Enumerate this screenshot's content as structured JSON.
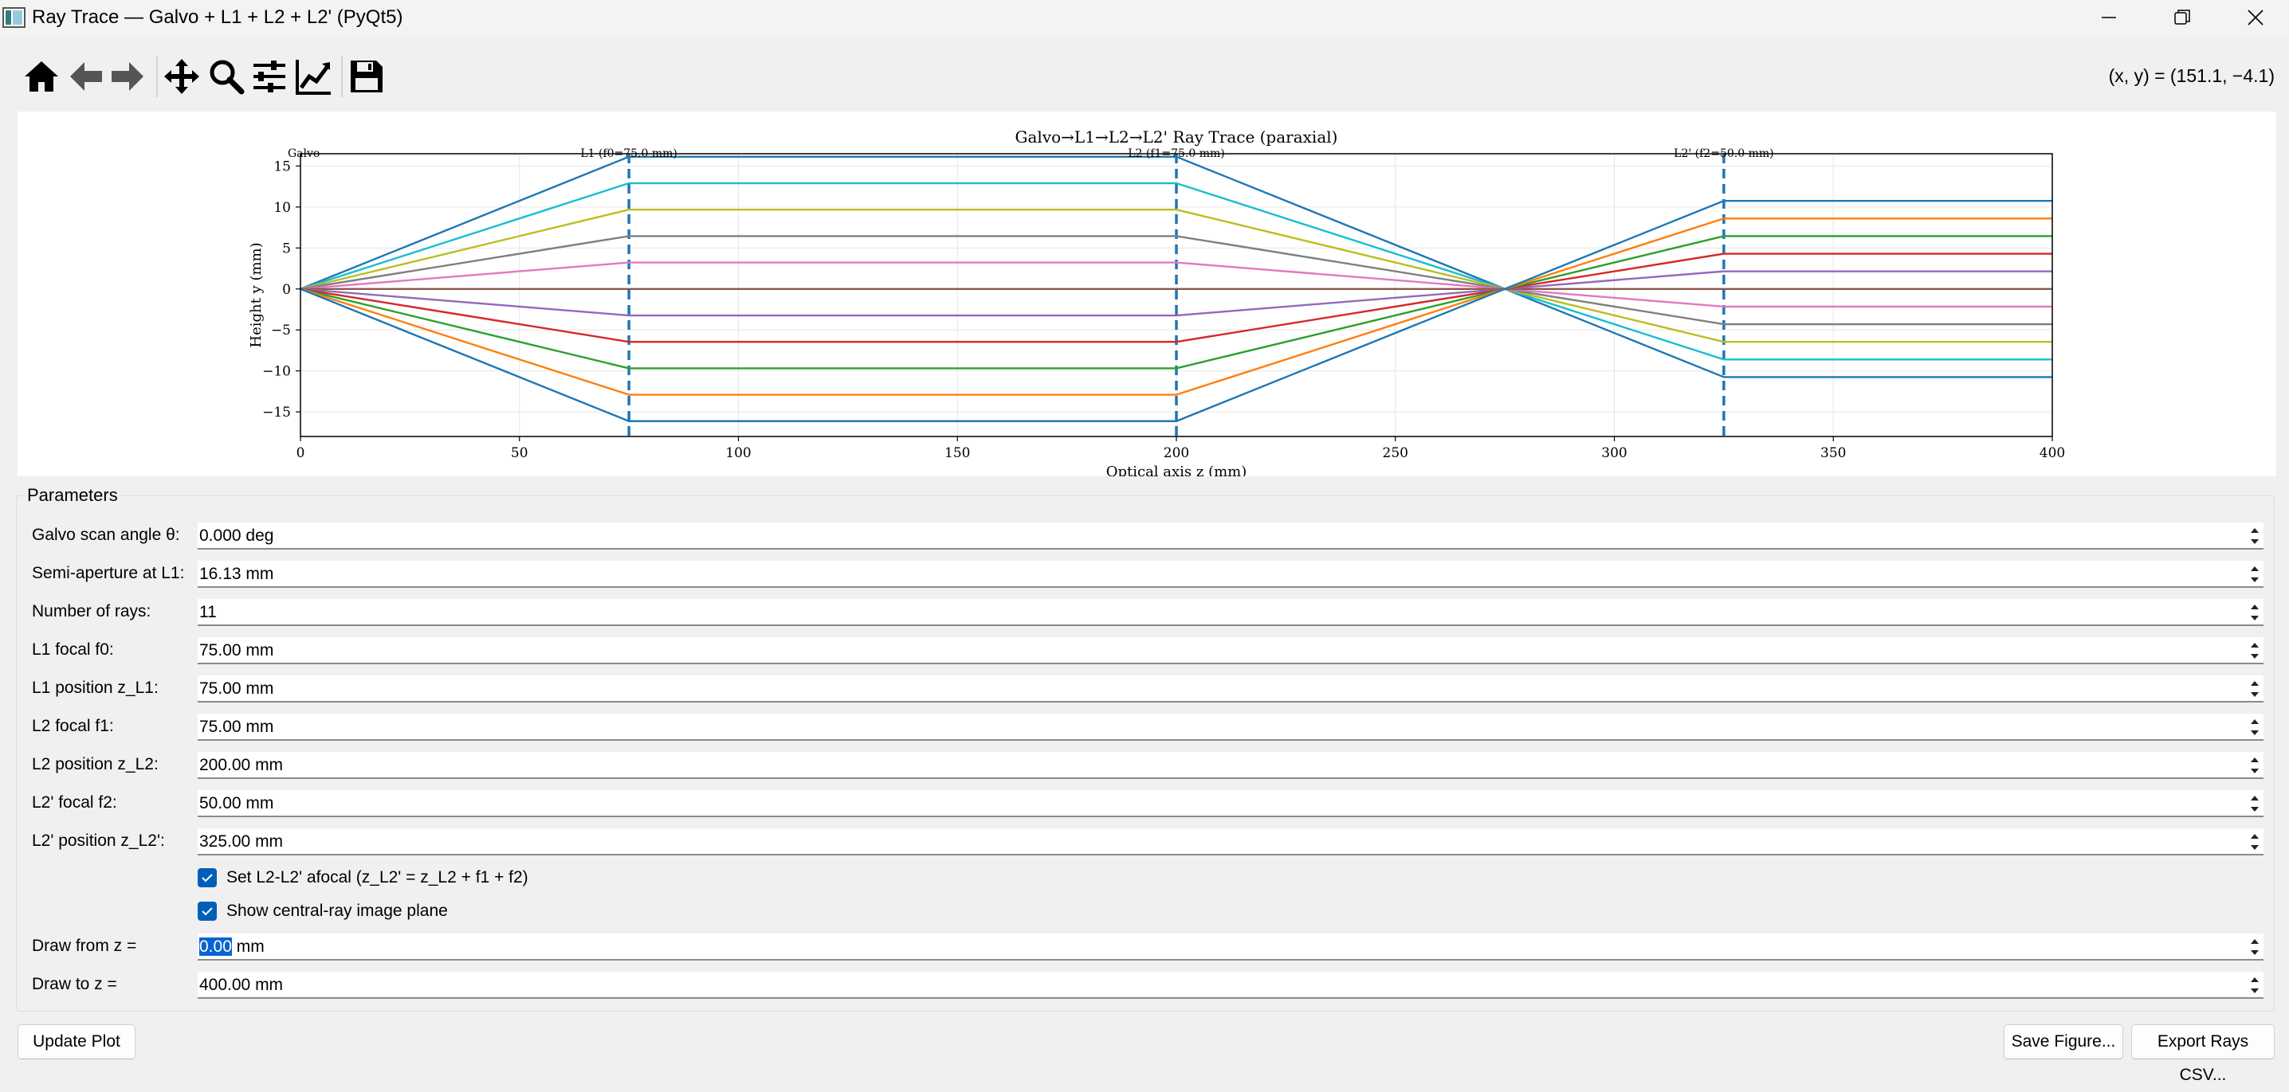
{
  "window": {
    "title": "Ray Trace — Galvo + L1 + L2 + L2' (PyQt5)"
  },
  "toolbar": {
    "coordinates": "(x, y) = (151.1, −4.1)"
  },
  "chart_data": {
    "type": "line",
    "title": "Galvo→L1→L2→L2' Ray Trace (paraxial)",
    "xlabel": "Optical axis z (mm)",
    "ylabel": "Height y (mm)",
    "xlim": [
      0,
      400
    ],
    "ylim": [
      -18,
      16.5
    ],
    "xticks": [
      0,
      50,
      100,
      150,
      200,
      250,
      300,
      350,
      400
    ],
    "yticks": [
      15,
      10,
      5,
      0,
      -5,
      -10,
      -15
    ],
    "ytick_labels": [
      "15",
      "10",
      "5",
      "0",
      "−5",
      "−10",
      "−15"
    ],
    "grid": true,
    "lens_labels": [
      {
        "z": 0,
        "text": "Galvo"
      },
      {
        "z": 75,
        "text": "L1 (f0=75.0 mm)"
      },
      {
        "z": 200,
        "text": "L2 (f1=75.0 mm)"
      },
      {
        "z": 325,
        "text": "L2' (f2=50.0 mm)"
      }
    ],
    "lens_lines_z": [
      75,
      200,
      325
    ],
    "lens_line_color": "#1f77b4",
    "rays_z": [
      0,
      75,
      200,
      275,
      325,
      400
    ],
    "series": [
      {
        "color": "#1f77b4",
        "y": [
          0,
          16.13,
          16.13,
          0,
          -10.75,
          -10.75
        ]
      },
      {
        "color": "#17becf",
        "y": [
          0,
          12.9,
          12.9,
          0,
          -8.6,
          -8.6
        ]
      },
      {
        "color": "#bcbd22",
        "y": [
          0,
          9.68,
          9.68,
          0,
          -6.45,
          -6.45
        ]
      },
      {
        "color": "#7f7f7f",
        "y": [
          0,
          6.45,
          6.45,
          0,
          -4.3,
          -4.3
        ]
      },
      {
        "color": "#e377c2",
        "y": [
          0,
          3.23,
          3.23,
          0,
          -2.15,
          -2.15
        ]
      },
      {
        "color": "#8c564b",
        "y": [
          0,
          0,
          0,
          0,
          0,
          0
        ]
      },
      {
        "color": "#9467bd",
        "y": [
          0,
          -3.23,
          -3.23,
          0,
          2.15,
          2.15
        ]
      },
      {
        "color": "#d62728",
        "y": [
          0,
          -6.45,
          -6.45,
          0,
          4.3,
          4.3
        ]
      },
      {
        "color": "#2ca02c",
        "y": [
          0,
          -9.68,
          -9.68,
          0,
          6.45,
          6.45
        ]
      },
      {
        "color": "#ff7f0e",
        "y": [
          0,
          -12.9,
          -12.9,
          0,
          8.6,
          8.6
        ]
      },
      {
        "color": "#1f77b4",
        "y": [
          0,
          -16.13,
          -16.13,
          0,
          10.75,
          10.75
        ]
      }
    ]
  },
  "params": {
    "title": "Parameters",
    "galvo_angle": {
      "label": "Galvo scan angle θ:",
      "value": "0.000 deg"
    },
    "semi_aperture": {
      "label": "Semi-aperture at L1:",
      "value": "16.13 mm"
    },
    "num_rays": {
      "label": "Number of rays:",
      "value": "11"
    },
    "l1_focal": {
      "label": "L1 focal f0:",
      "value": "75.00 mm"
    },
    "l1_pos": {
      "label": "L1 position z_L1:",
      "value": "75.00 mm"
    },
    "l2_focal": {
      "label": "L2 focal f1:",
      "value": "75.00 mm"
    },
    "l2_pos": {
      "label": "L2 position z_L2:",
      "value": "200.00 mm"
    },
    "l2p_focal": {
      "label": "L2' focal f2:",
      "value": "50.00 mm"
    },
    "l2p_pos": {
      "label": "L2' position z_L2':",
      "value": "325.00 mm"
    },
    "afocal_check": {
      "label": "Set L2-L2' afocal (z_L2' = z_L2 + f1 + f2)",
      "checked": true
    },
    "image_plane_check": {
      "label": "Show central-ray image plane",
      "checked": true
    },
    "draw_from": {
      "label": "Draw from z =",
      "selected": "0.00",
      "suffix": " mm"
    },
    "draw_to": {
      "label": "Draw to z =",
      "value": "400.00 mm"
    }
  },
  "buttons": {
    "update": "Update Plot",
    "save": "Save Figure...",
    "export": "Export Rays CSV..."
  }
}
